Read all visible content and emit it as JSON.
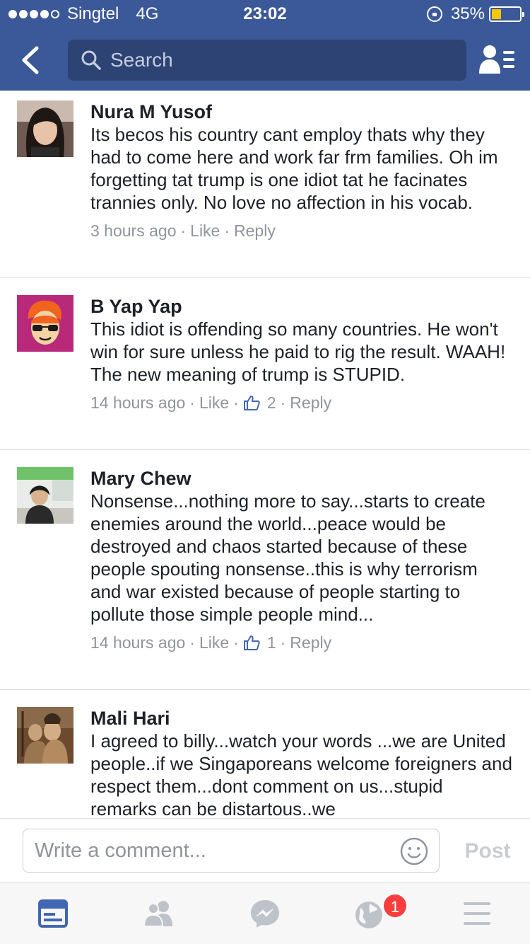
{
  "status_bar": {
    "carrier": "Singtel",
    "network": "4G",
    "time": "23:02",
    "battery": "35%",
    "battery_level": 0.35,
    "signal_bars": 4
  },
  "header": {
    "search_placeholder": "Search",
    "color": "#3b5998"
  },
  "comments": [
    {
      "author": "Nura M Yusof",
      "text": "Its becos his country cant employ thats why they had to come here and work far frm families. Oh im forgetting tat trump is one idiot tat he facinates trannies only. No love no affection in his vocab.",
      "time": "3 hours ago",
      "like_label": "Like",
      "like_count": "",
      "reply_label": "Reply",
      "avatar": "woman-avatar"
    },
    {
      "author": "B Yap Yap",
      "text": "This idiot is offending so many countries. He won't win for sure unless he paid to rig the result. WAAH! The new meaning of trump is STUPID.",
      "time": "14 hours ago",
      "like_label": "Like",
      "like_count": "2",
      "reply_label": "Reply",
      "avatar": "cartoon-avatar"
    },
    {
      "author": "Mary Chew",
      "text": "Nonsense...nothing more to say...starts to create enemies around the world...peace would be destroyed and chaos started because of these people spouting nonsense..this is why terrorism and war existed because of people starting to pollute those simple people mind...",
      "time": "14 hours ago",
      "like_label": "Like",
      "like_count": "1",
      "reply_label": "Reply",
      "avatar": "office-avatar"
    },
    {
      "author": "Mali Hari",
      "text": "I agreed to billy...watch your words ...we are United people..if we Singaporeans welcome foreigners and respect them...dont comment on us...stupid remarks can be distartous..we",
      "time": "",
      "like_label": "",
      "like_count": "",
      "reply_label": "",
      "avatar": "deity-avatar"
    }
  ],
  "composer": {
    "placeholder": "Write a comment...",
    "post_label": "Post"
  },
  "tabbar": {
    "notifications_badge": "1",
    "active_color": "#4267b2",
    "inactive_color": "#bec3c9"
  }
}
